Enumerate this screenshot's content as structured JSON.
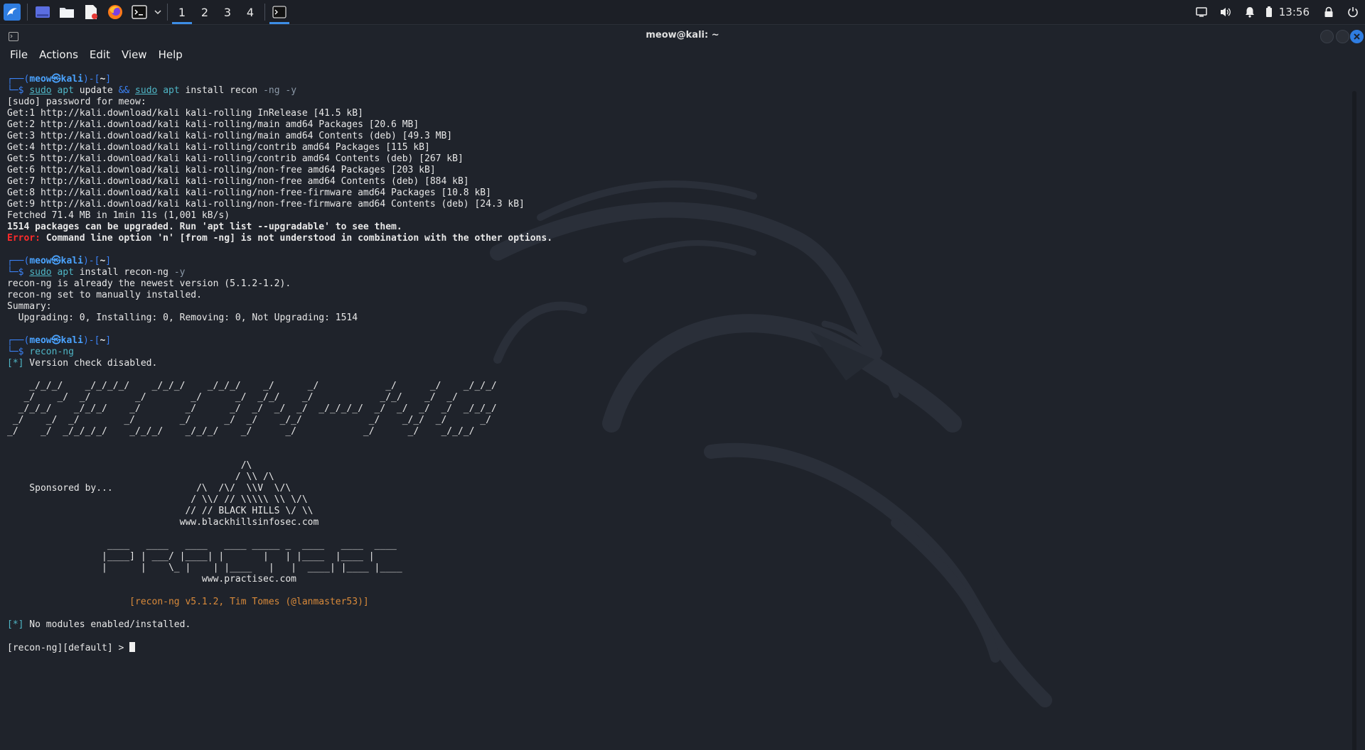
{
  "panel": {
    "workspaces": [
      "1",
      "2",
      "3",
      "4"
    ],
    "clock": "13:56"
  },
  "window": {
    "title": "meow@kali: ~"
  },
  "menu": [
    "File",
    "Actions",
    "Edit",
    "View",
    "Help"
  ],
  "terminal": {
    "cmd1": {
      "user": "meow",
      "host": "kali",
      "dir": "~",
      "sudo1": "sudo",
      "apt1": "apt",
      "args1": " update ",
      "op": "&&",
      "sudo2": "sudo",
      "apt2": "apt",
      "args2": " install recon ",
      "flags": "-ng -y"
    },
    "out1": [
      "[sudo] password for meow:",
      "Get:1 http://kali.download/kali kali-rolling InRelease [41.5 kB]",
      "Get:2 http://kali.download/kali kali-rolling/main amd64 Packages [20.6 MB]",
      "Get:3 http://kali.download/kali kali-rolling/main amd64 Contents (deb) [49.3 MB]",
      "Get:4 http://kali.download/kali kali-rolling/contrib amd64 Packages [115 kB]",
      "Get:5 http://kali.download/kali kali-rolling/contrib amd64 Contents (deb) [267 kB]",
      "Get:6 http://kali.download/kali kali-rolling/non-free amd64 Packages [203 kB]",
      "Get:7 http://kali.download/kali kali-rolling/non-free amd64 Contents (deb) [884 kB]",
      "Get:8 http://kali.download/kali kali-rolling/non-free-firmware amd64 Packages [10.8 kB]",
      "Get:9 http://kali.download/kali kali-rolling/non-free-firmware amd64 Contents (deb) [24.3 kB]",
      "Fetched 71.4 MB in 1min 11s (1,001 kB/s)"
    ],
    "upgrade_msg": "1514 packages can be upgraded. Run 'apt list --upgradable' to see them.",
    "error_label": "Error:",
    "error_msg": " Command line option 'n' [from -ng] is not understood in combination with the other options.",
    "cmd2": {
      "sudo": "sudo",
      "apt": "apt",
      "args": " install recon-ng ",
      "flags": "-y"
    },
    "out2": [
      "recon-ng is already the newest version (5.1.2-1.2).",
      "recon-ng set to manually installed.",
      "Summary:",
      "  Upgrading: 0, Installing: 0, Removing: 0, Not Upgrading: 1514"
    ],
    "cmd3": "recon-ng",
    "version_check": " Version check disabled.",
    "star": "[*]",
    "banner": [
      "    _/_/_/    _/_/_/_/    _/_/_/    _/_/_/    _/      _/            _/      _/    _/_/_/",
      "   _/    _/  _/        _/        _/      _/  _/_/    _/            _/_/    _/  _/",
      "  _/_/_/    _/_/_/    _/        _/      _/  _/  _/  _/  _/_/_/_/  _/  _/  _/  _/  _/_/_/",
      " _/    _/  _/        _/        _/      _/  _/    _/_/            _/    _/_/  _/      _/",
      "_/    _/  _/_/_/_/    _/_/_/    _/_/_/    _/      _/            _/      _/    _/_/_/"
    ],
    "sponsor": [
      "                                          /\\",
      "                                         / \\\\ /\\",
      "    Sponsored by...               /\\  /\\/  \\\\V  \\/\\",
      "                                 / \\\\/ // \\\\\\\\\\ \\\\ \\/\\",
      "                                // // BLACK HILLS \\/ \\\\",
      "                               www.blackhillsinfosec.com"
    ],
    "practisec": [
      "                  ____   ____   ____   ____ _____ _  ____   ____  ____",
      "                 |____] | ___/ |____| |       |   | |____  |____ |",
      "                 |      |    \\_ |    | |____   |   |  ____| |____ |____",
      "                                   www.practisec.com"
    ],
    "credits": "                      [recon-ng v5.1.2, Tim Tomes (@lanmaster53)]",
    "no_modules": " No modules enabled/installed.",
    "prompt": "[recon-ng][default] > "
  }
}
